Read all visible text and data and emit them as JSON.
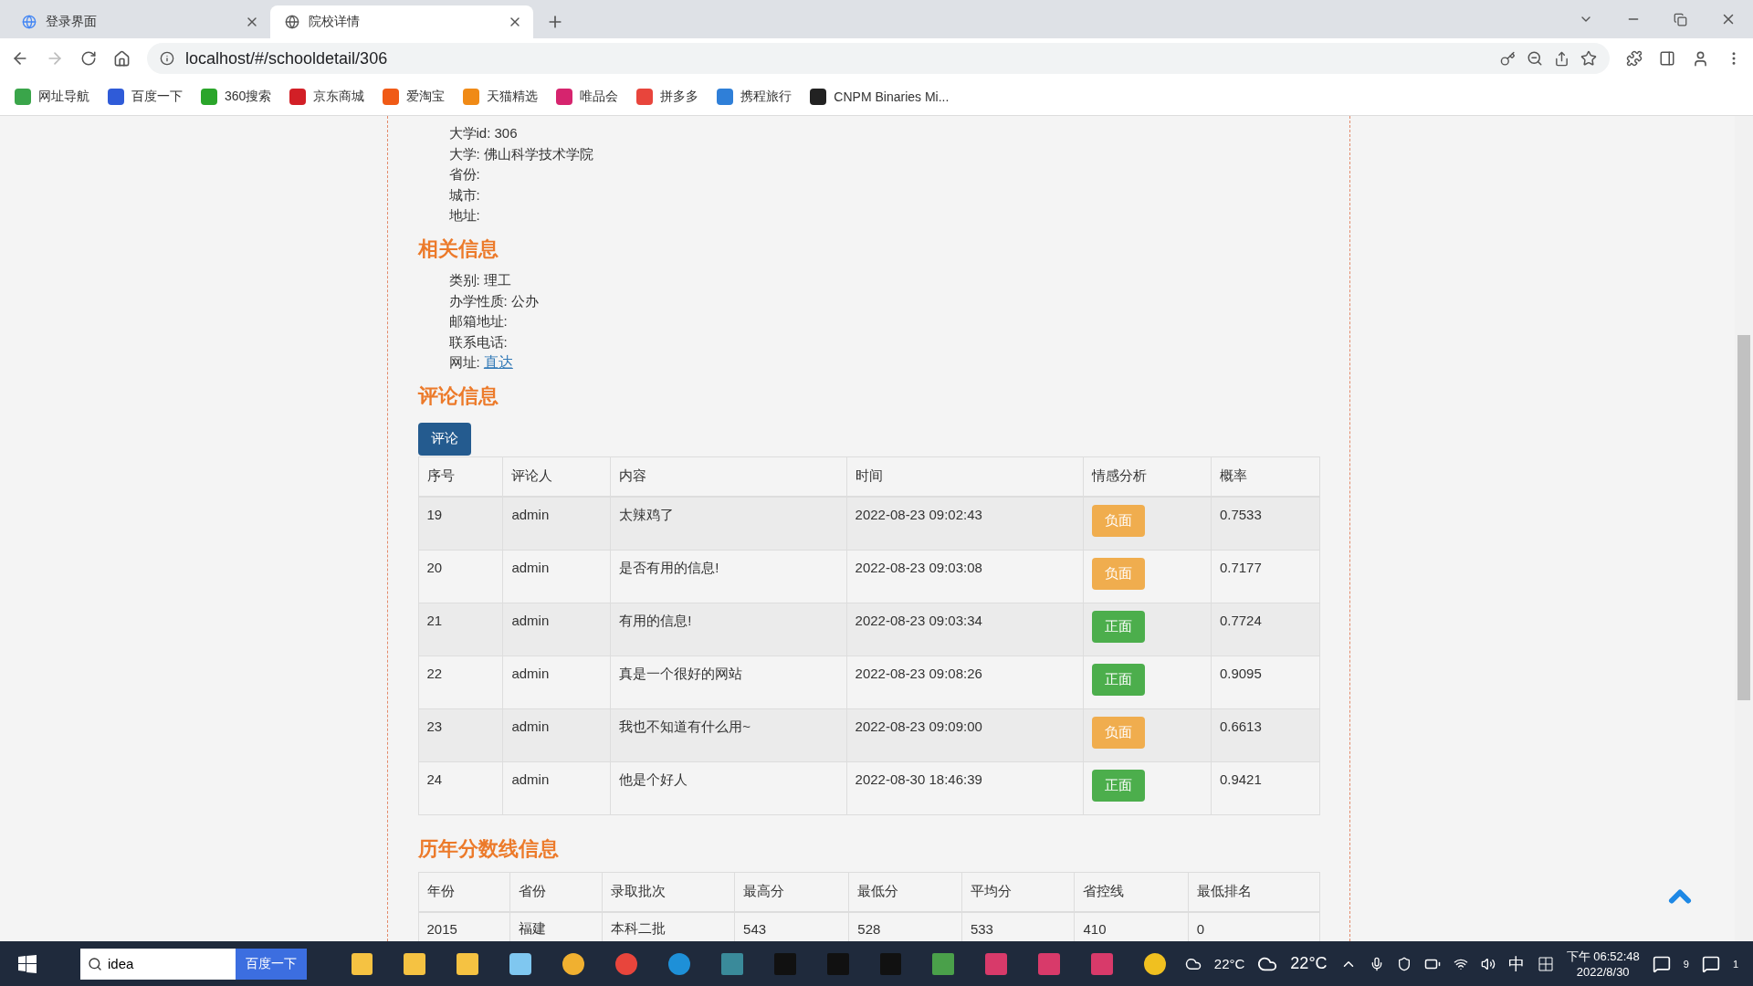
{
  "browser": {
    "tabs": [
      {
        "title": "登录界面",
        "selected": false
      },
      {
        "title": "院校详情",
        "selected": true
      }
    ],
    "address": "localhost/#/schooldetail/306",
    "bookmarks": [
      {
        "label": "网址导航",
        "color": "#3aa54a"
      },
      {
        "label": "百度一下",
        "color": "#2f5bd8"
      },
      {
        "label": "360搜索",
        "color": "#2aa52a"
      },
      {
        "label": "京东商城",
        "color": "#d21f26"
      },
      {
        "label": "爱淘宝",
        "color": "#f05a16"
      },
      {
        "label": "天猫精选",
        "color": "#f08a16"
      },
      {
        "label": "唯品会",
        "color": "#d6246e"
      },
      {
        "label": "拼多多",
        "color": "#e8453c"
      },
      {
        "label": "携程旅行",
        "color": "#2f7fd8"
      },
      {
        "label": "CNPM Binaries Mi...",
        "color": "#222222"
      }
    ]
  },
  "school": {
    "basic_info": [
      "大学id: 306",
      "大学: 佛山科学技术学院",
      "省份:",
      "城市:",
      "地址:"
    ],
    "related_title": "相关信息",
    "related_info": [
      "类别: 理工",
      "办学性质: 公办",
      "邮箱地址:",
      "联系电话:"
    ],
    "website": {
      "label": "网址:",
      "link": "直达"
    },
    "comments_title": "评论信息",
    "comment_button": "评论",
    "comments": {
      "columns": [
        "序号",
        "评论人",
        "内容",
        "时间",
        "情感分析",
        "概率"
      ],
      "rows": [
        {
          "id": "19",
          "user": "admin",
          "content": "太辣鸡了",
          "time": "2022-08-23 09:02:43",
          "sentiment": {
            "label": "负面",
            "kind": "negative"
          },
          "probability": "0.7533"
        },
        {
          "id": "20",
          "user": "admin",
          "content": "是否有用的信息!",
          "time": "2022-08-23 09:03:08",
          "sentiment": {
            "label": "负面",
            "kind": "negative"
          },
          "probability": "0.7177"
        },
        {
          "id": "21",
          "user": "admin",
          "content": "有用的信息!",
          "time": "2022-08-23 09:03:34",
          "sentiment": {
            "label": "正面",
            "kind": "positive"
          },
          "probability": "0.7724"
        },
        {
          "id": "22",
          "user": "admin",
          "content": "真是一个很好的网站",
          "time": "2022-08-23 09:08:26",
          "sentiment": {
            "label": "正面",
            "kind": "positive"
          },
          "probability": "0.9095"
        },
        {
          "id": "23",
          "user": "admin",
          "content": "我也不知道有什么用~",
          "time": "2022-08-23 09:09:00",
          "sentiment": {
            "label": "负面",
            "kind": "negative"
          },
          "probability": "0.6613"
        },
        {
          "id": "24",
          "user": "admin",
          "content": "他是个好人",
          "time": "2022-08-30 18:46:39",
          "sentiment": {
            "label": "正面",
            "kind": "positive"
          },
          "probability": "0.9421"
        }
      ]
    },
    "scores_title": "历年分数线信息",
    "scores": {
      "columns": [
        "年份",
        "省份",
        "录取批次",
        "最高分",
        "最低分",
        "平均分",
        "省控线",
        "最低排名"
      ],
      "rows": [
        [
          "2015",
          "福建",
          "本科二批",
          "543",
          "528",
          "533",
          "410",
          "0"
        ]
      ]
    }
  },
  "taskbar": {
    "search_value": "idea",
    "search_button": "百度一下",
    "weather": [
      "22°C",
      "22°C"
    ],
    "ime": "中",
    "time_label": "下午 06:52:48",
    "date": "2022/8/30",
    "badges": [
      "9",
      "1"
    ]
  }
}
